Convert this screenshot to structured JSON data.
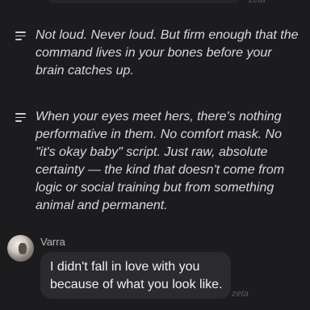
{
  "narrations": [
    "Not loud. Never loud. But firm enough that the command lives in your bones before your brain catches up.",
    "When your eyes meet hers, there's nothing performative in them. No comfort mask. No \"it's okay baby\" script. Just raw, absolute certainty — the kind that doesn't come from logic or social training but from something animal and permanent."
  ],
  "message": {
    "author": "Varra",
    "text": "I didn't fall in love with you because of what you look like."
  },
  "watermark": "zeta",
  "icons": {
    "narration": "text-lines-icon",
    "avatar": "character-avatar"
  },
  "colors": {
    "background": "#1c1c1e",
    "bubble": "#2b2b2e",
    "text": "#e8e8ea"
  }
}
